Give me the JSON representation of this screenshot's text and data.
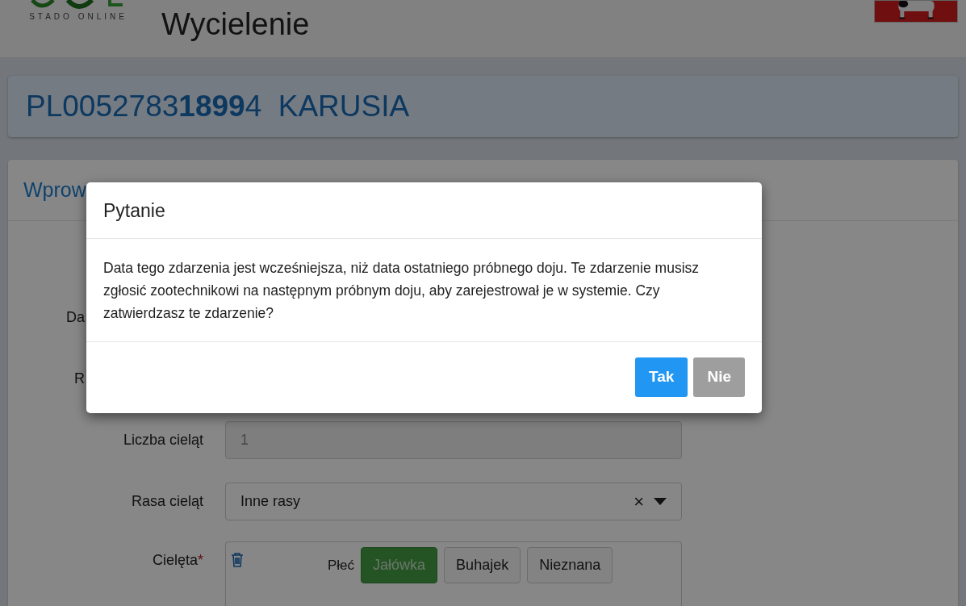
{
  "header": {
    "logo_text": "STADO ONLINE",
    "title": "Wycielenie"
  },
  "animal": {
    "id": "PL0052783**1899**4",
    "name": "KARUSIA"
  },
  "form": {
    "title": "Wprow",
    "fields": [
      {
        "kind": "hidden",
        "label": "Da"
      },
      {
        "kind": "hidden",
        "label": "R"
      },
      {
        "kind": "input",
        "label": "Liczba cieląt",
        "value": "1",
        "disabled": true
      },
      {
        "kind": "select",
        "label": "Rasa cieląt",
        "value": "Inne rasy",
        "clear": "×"
      },
      {
        "kind": "calves",
        "label": "Cielęta",
        "required_mark": "*",
        "sex_label": "Płeć",
        "options": [
          {
            "label": "Jałówka",
            "selected": true
          },
          {
            "label": "Buhajek",
            "selected": false
          },
          {
            "label": "Nieznana",
            "selected": false
          }
        ]
      }
    ]
  },
  "modal": {
    "title": "Pytanie",
    "message": "Data tego zdarzenia jest wcześniejsza, niż data ostatniego próbnego doju. Te zdarzenie musisz zgłosić zootechnikowi na następnym próbnym doju, aby zarejestrował je w systemie. Czy zatwierdzasz te zdarzenie?",
    "buttons": [
      {
        "label": "Tak",
        "kind": "primary"
      },
      {
        "label": "Nie",
        "kind": "secondary"
      }
    ]
  }
}
